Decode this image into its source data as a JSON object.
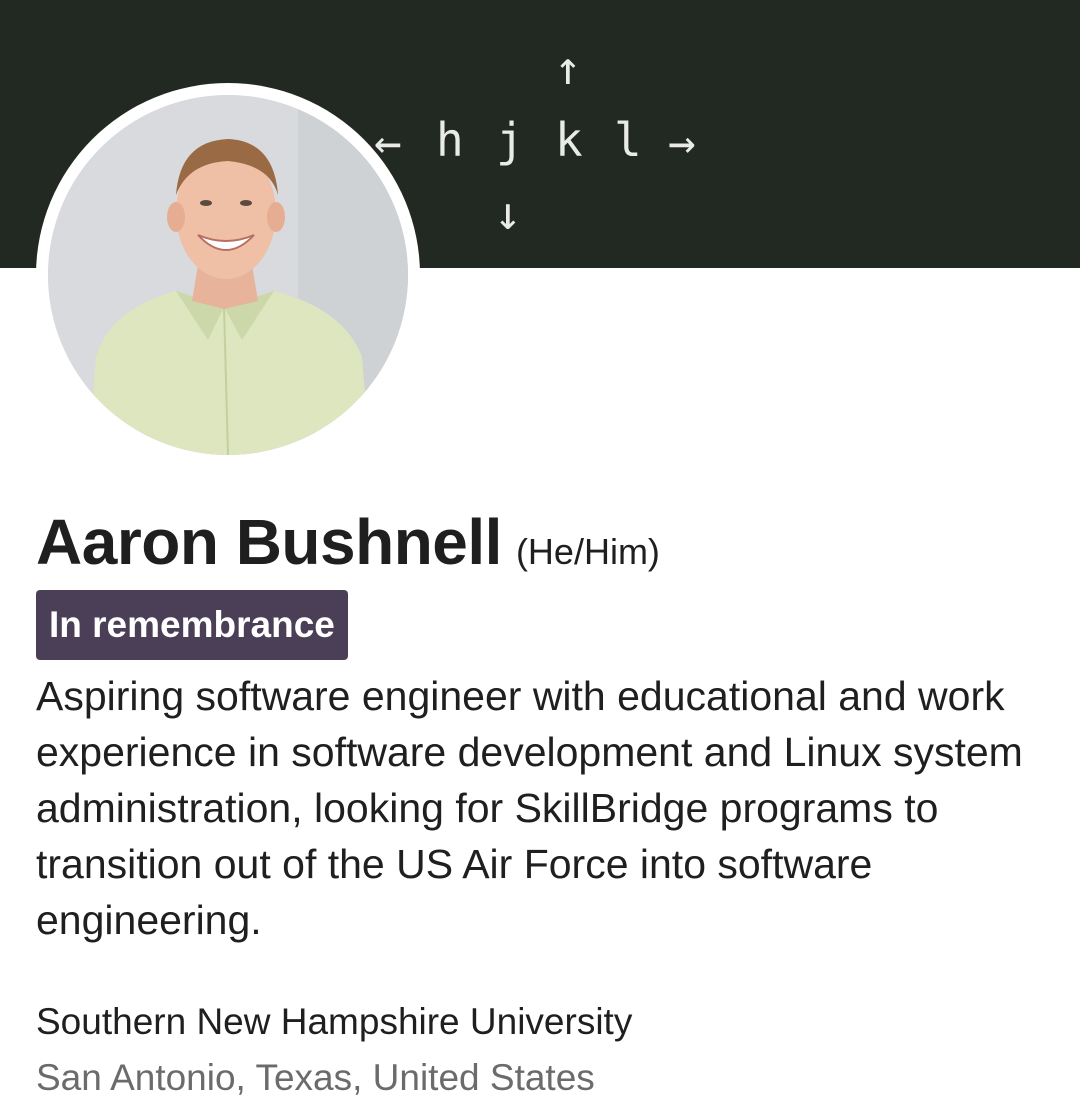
{
  "cover": {
    "keys": {
      "h": "h",
      "j": "j",
      "k": "k",
      "l": "l"
    },
    "arrows": {
      "left": "←",
      "right": "→",
      "up": "↑",
      "down": "↓"
    }
  },
  "profile": {
    "name": "Aaron Bushnell",
    "pronouns": "(He/Him)",
    "badge": "In remembrance",
    "headline": "Aspiring software engineer with educational and work experience in software development and Linux system administration, looking for SkillBridge programs to transition out of the US Air Force into software engineering.",
    "education": "Southern New Hampshire University",
    "location": "San Antonio, Texas, United States"
  },
  "colors": {
    "cover_background": "#222822",
    "badge_background": "#4b3f58",
    "text_primary": "#1f1f1f",
    "text_secondary": "#6b6b6b"
  }
}
